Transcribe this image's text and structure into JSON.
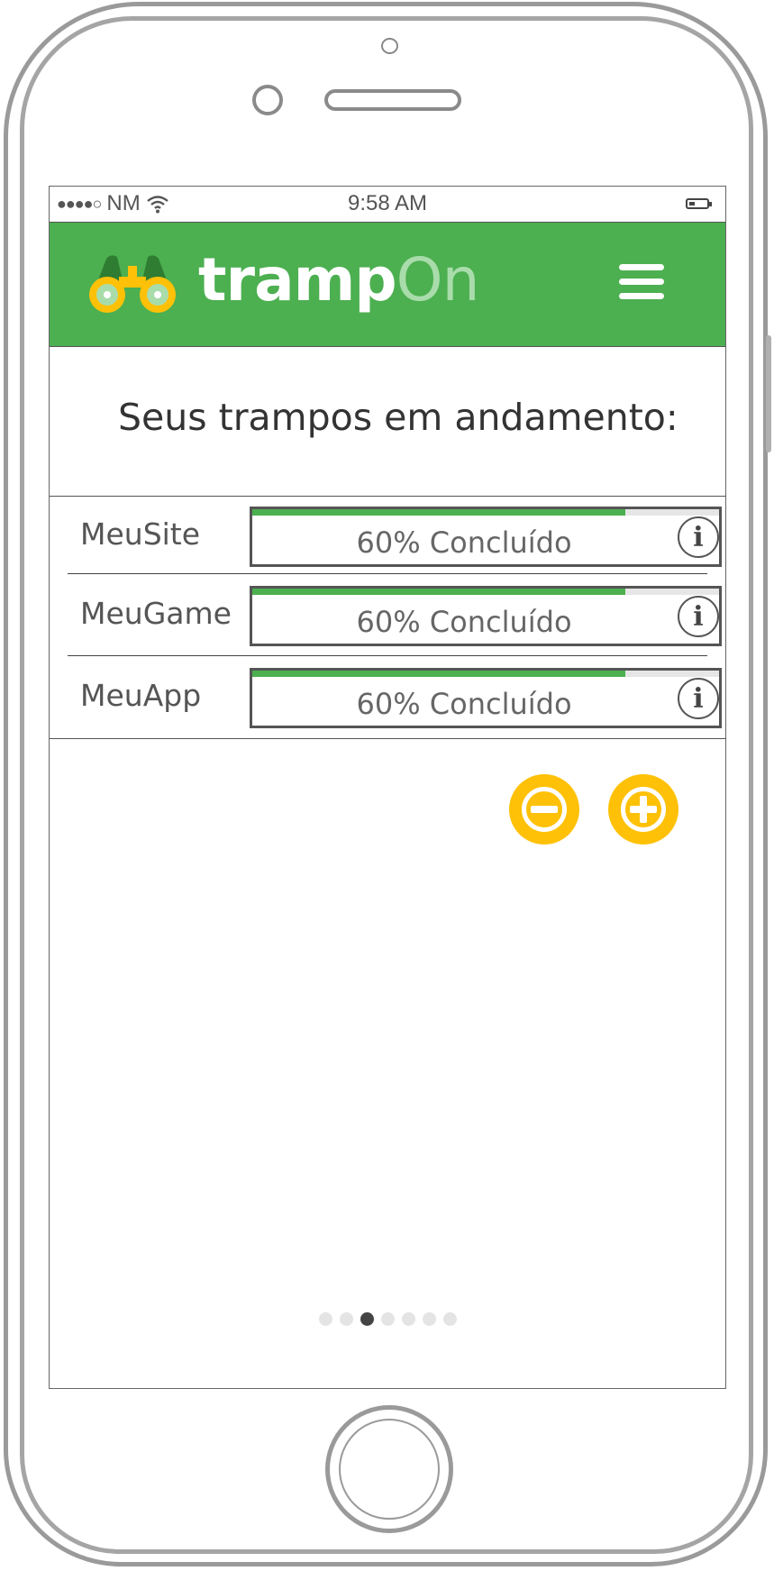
{
  "status_bar": {
    "signal": "●●●●○",
    "carrier": "NM",
    "time": "9:58 AM"
  },
  "header": {
    "brand_bold": "tramp",
    "brand_light": "On",
    "logo_icon": "binoculars-icon",
    "menu_icon": "hamburger-menu-icon",
    "colors": {
      "header_bg": "#4caf50",
      "brand_accent": "#a9dcab",
      "logo": "#ffc107"
    }
  },
  "main": {
    "title": "Seus trampos em andamento:"
  },
  "jobs": [
    {
      "name": "MeuSite",
      "progress": 0.8,
      "progress_label": "60% Concluído",
      "info_label": "i"
    },
    {
      "name": "MeuGame",
      "progress": 0.8,
      "progress_label": "60% Concluído",
      "info_label": "i"
    },
    {
      "name": "MeuApp",
      "progress": 0.8,
      "progress_label": "60% Concluído",
      "info_label": "i"
    }
  ],
  "actions": {
    "remove_icon": "minus-circle-icon",
    "add_icon": "plus-circle-icon",
    "color": "#ffc107"
  },
  "pagination": {
    "total": 7,
    "current": 3
  }
}
